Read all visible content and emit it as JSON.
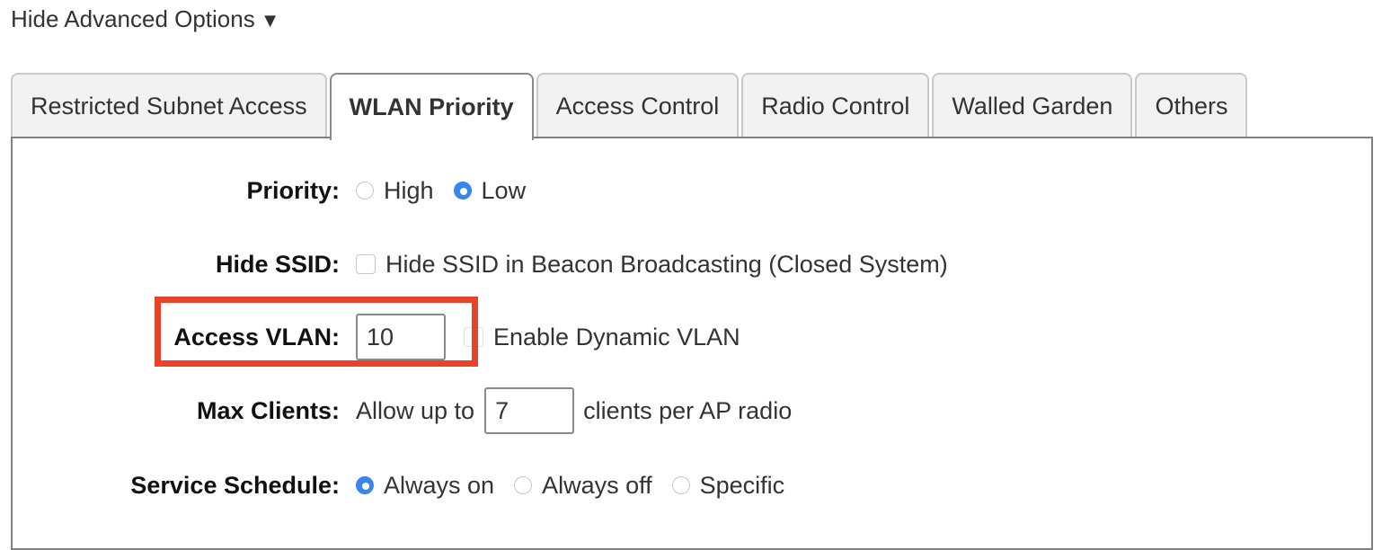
{
  "advanced_toggle": {
    "label": "Hide Advanced Options",
    "icon": "triangle-down-icon",
    "glyph": "▼"
  },
  "tabs": [
    {
      "label": "Restricted Subnet Access",
      "active": false
    },
    {
      "label": "WLAN Priority",
      "active": true
    },
    {
      "label": "Access Control",
      "active": false
    },
    {
      "label": "Radio Control",
      "active": false
    },
    {
      "label": "Walled Garden",
      "active": false
    },
    {
      "label": "Others",
      "active": false
    }
  ],
  "form": {
    "priority": {
      "label": "Priority:",
      "options": [
        {
          "label": "High",
          "checked": false
        },
        {
          "label": "Low",
          "checked": true
        }
      ]
    },
    "hide_ssid": {
      "label": "Hide SSID:",
      "checkbox_label": "Hide SSID in Beacon Broadcasting (Closed System)",
      "checked": false
    },
    "access_vlan": {
      "label": "Access VLAN:",
      "value": "10",
      "dynamic_vlan_label": "Enable Dynamic VLAN",
      "dynamic_vlan_checked": false,
      "dynamic_vlan_disabled": true,
      "highlight_color": "#e8422a"
    },
    "max_clients": {
      "label": "Max Clients:",
      "prefix": "Allow up to",
      "value": "7",
      "suffix": "clients per AP radio"
    },
    "service_schedule": {
      "label": "Service Schedule:",
      "options": [
        {
          "label": "Always on",
          "checked": true
        },
        {
          "label": "Always off",
          "checked": false
        },
        {
          "label": "Specific",
          "checked": false
        }
      ]
    }
  },
  "colors": {
    "accent": "#3a84f0",
    "panel_border": "#808080",
    "tab_bg": "#f2f2f2"
  }
}
